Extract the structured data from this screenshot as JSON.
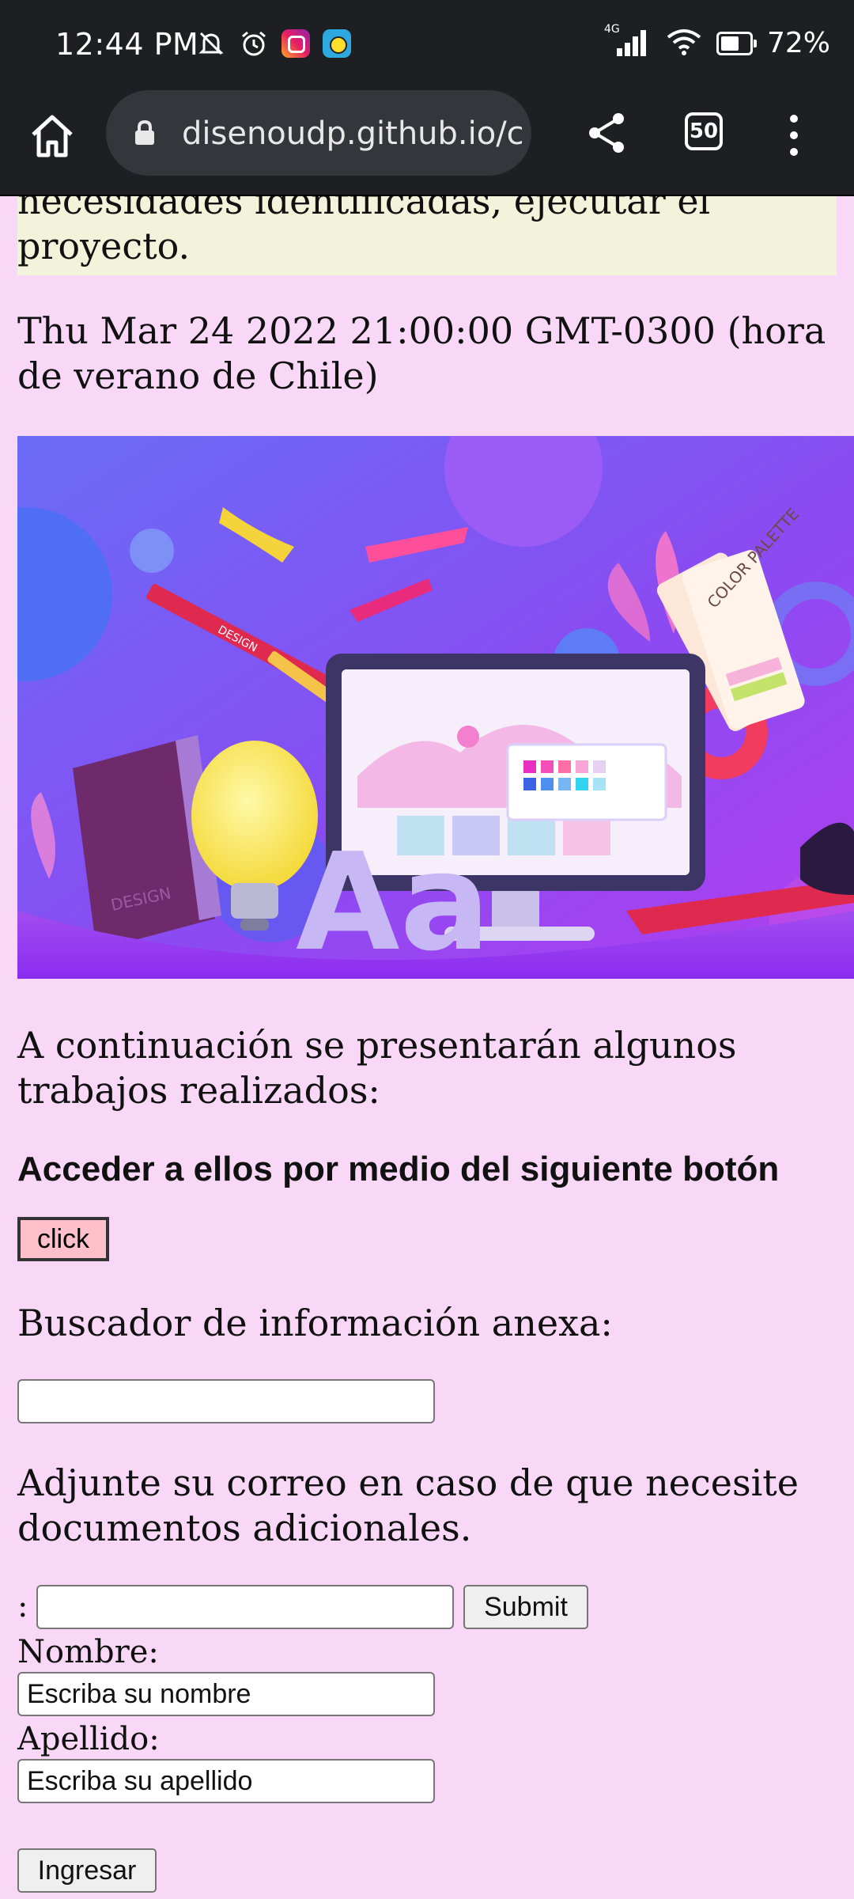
{
  "status_bar": {
    "time": "12:44 PM",
    "icons_left": [
      "mute-icon",
      "alarm-icon",
      "instagram-icon",
      "game-app-icon"
    ],
    "network": "4G",
    "battery": "72%"
  },
  "browser": {
    "url": "disenoudp.github.io/c",
    "tab_count": "50"
  },
  "page": {
    "intro_text": "necesidades identificadas, ejecutar el proyecto.",
    "date_text": "Thu Mar 24 2022 21:00:00 GMT-0300 (hora de verano de Chile)",
    "image": {
      "palette_card_text": "COLOR PALETTE",
      "pencil_text": "DESIGN",
      "book_text": "DESIGN",
      "letters": "Aa"
    },
    "works_text": "A continuación se presentarán algunos trabajos realizados:",
    "access_heading": "Acceder a ellos por medio del siguiente botón",
    "click_button": "click",
    "search_label": "Buscador de información anexa:",
    "search_value": "",
    "email_text": "Adjunte su correo en caso de que necesite documentos adicionales.",
    "email_prefix": ":",
    "email_value": "",
    "submit_button": "Submit",
    "name_label": "Nombre:",
    "name_placeholder": "Escriba su nombre",
    "surname_label": "Apellido:",
    "surname_placeholder": "Escriba su apellido",
    "login_button": "Ingresar"
  },
  "colors": {
    "page_background": "#f9d7f7",
    "beige_block": "#f3f3dc",
    "click_button": "#ffc0cb",
    "browser_chrome": "#1e1f22"
  }
}
